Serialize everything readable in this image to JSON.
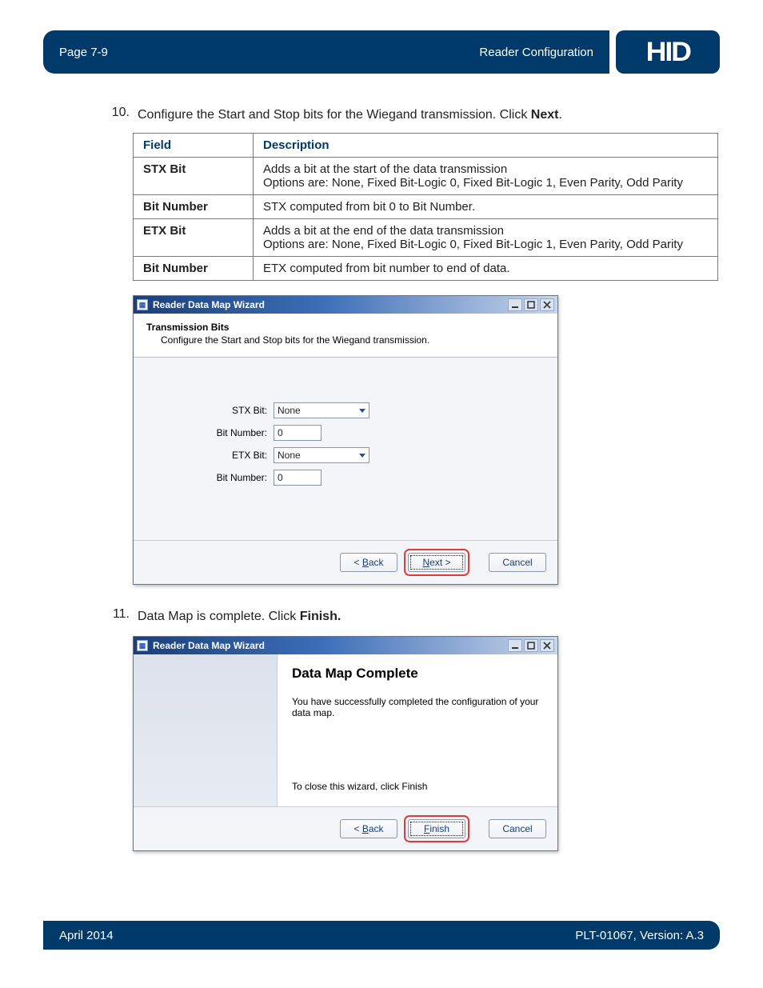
{
  "header": {
    "page_label": "Page 7-9",
    "section": "Reader Configuration",
    "logo_text": "HID"
  },
  "steps": {
    "s10": {
      "num": "10.",
      "text_a": "Configure the Start and Stop bits for the Wiegand transmission. Click ",
      "text_b": "Next",
      "text_c": "."
    },
    "s11": {
      "num": "11.",
      "text_a": "Data Map is complete. Click ",
      "text_b": "Finish.",
      "text_c": ""
    }
  },
  "table": {
    "head_field": "Field",
    "head_desc": "Description",
    "rows": [
      {
        "field": "STX Bit",
        "desc": "Adds a bit at the start of the data transmission\nOptions are: None, Fixed Bit-Logic 0, Fixed Bit-Logic 1, Even Parity, Odd Parity"
      },
      {
        "field": "Bit Number",
        "desc": "STX computed from bit 0 to Bit Number."
      },
      {
        "field": "ETX Bit",
        "desc": "Adds a bit at the end of the data transmission\nOptions are: None, Fixed Bit-Logic 0, Fixed Bit-Logic 1, Even Parity, Odd Parity"
      },
      {
        "field": "Bit Number",
        "desc": "ETX computed from bit number to end of data."
      }
    ]
  },
  "wizard1": {
    "title": "Reader Data Map Wizard",
    "header_title": "Transmission Bits",
    "header_sub": "Configure the Start and Stop bits for the Wiegand transmission.",
    "fields": {
      "stx_label": "STX Bit:",
      "stx_value": "None",
      "bit1_label": "Bit Number:",
      "bit1_value": "0",
      "etx_label": "ETX Bit:",
      "etx_value": "None",
      "bit2_label": "Bit Number:",
      "bit2_value": "0"
    },
    "buttons": {
      "back_pre": "< ",
      "back_u": "B",
      "back_post": "ack",
      "next_u": "N",
      "next_post": "ext >",
      "cancel": "Cancel"
    }
  },
  "wizard2": {
    "title": "Reader Data Map Wizard",
    "heading": "Data Map Complete",
    "line1": "You have successfully completed the configuration of your data map.",
    "line2": "To close this wizard, click Finish",
    "buttons": {
      "back_pre": "< ",
      "back_u": "B",
      "back_post": "ack",
      "finish_u": "F",
      "finish_post": "inish",
      "cancel": "Cancel"
    }
  },
  "footer": {
    "left": "April 2014",
    "right": "PLT-01067, Version: A.3"
  }
}
